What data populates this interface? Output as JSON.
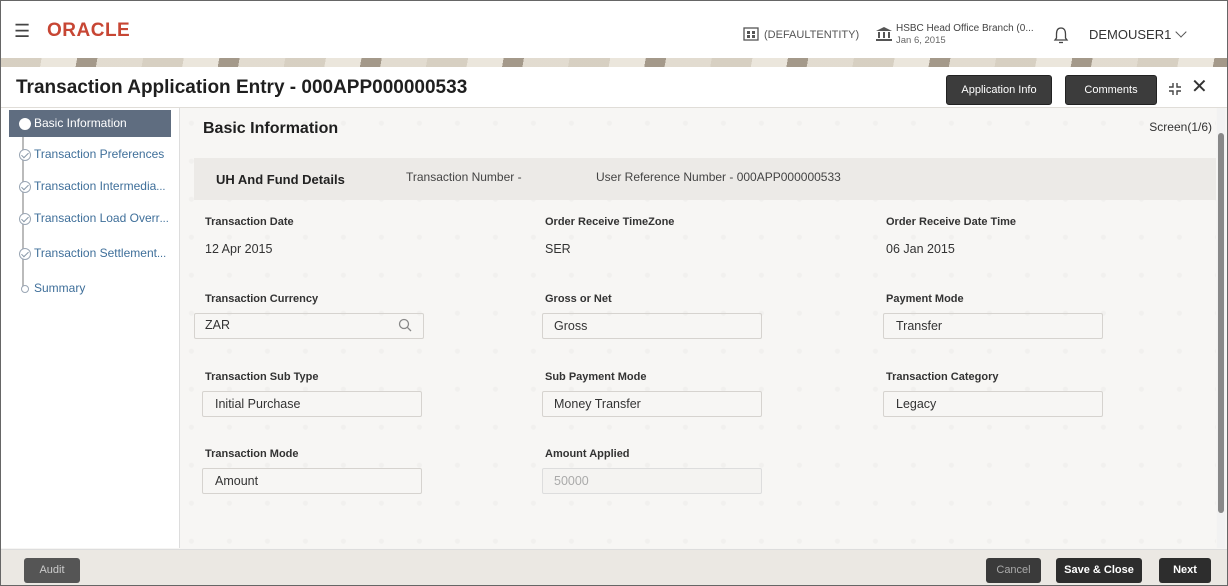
{
  "header": {
    "logo": "ORACLE",
    "entity": "(DEFAULTENTITY)",
    "branch_name": "HSBC Head Office Branch (0...",
    "branch_date": "Jan 6, 2015",
    "user": "DEMOUSER1",
    "brand_color": "#c74634"
  },
  "titlebar": {
    "title": "Transaction Application Entry - 000APP000000533",
    "app_info": "Application Info",
    "comments": "Comments"
  },
  "sidebar": {
    "items": [
      {
        "label": "Basic Information",
        "active": true
      },
      {
        "label": "Transaction Preferences"
      },
      {
        "label": "Transaction Intermedia",
        "ellipsis": "..."
      },
      {
        "label": "Transaction Load Overr",
        "ellipsis": "..."
      },
      {
        "label": "Transaction Settlement",
        "ellipsis": "..."
      },
      {
        "label": "Summary"
      }
    ]
  },
  "main": {
    "section_title": "Basic Information",
    "screen_counter": "Screen(1/6)",
    "tabs": {
      "uh_fund": "UH And Fund Details",
      "txn_number": "Transaction Number -",
      "user_ref": "User Reference Number - 000APP000000533"
    },
    "fields": {
      "transaction_date": {
        "label": "Transaction Date",
        "value": "12 Apr 2015"
      },
      "order_tz": {
        "label": "Order Receive TimeZone",
        "value": "SER"
      },
      "order_dt": {
        "label": "Order Receive Date Time",
        "value": "06 Jan 2015"
      },
      "currency": {
        "label": "Transaction Currency",
        "value": "ZAR"
      },
      "gross_net": {
        "label": "Gross or Net",
        "value": "Gross"
      },
      "payment_mode": {
        "label": "Payment Mode",
        "value": "Transfer"
      },
      "sub_type": {
        "label": "Transaction Sub Type",
        "value": "Initial Purchase"
      },
      "sub_payment": {
        "label": "Sub Payment Mode",
        "value": "Money Transfer"
      },
      "category": {
        "label": "Transaction Category",
        "value": "Legacy"
      },
      "mode": {
        "label": "Transaction Mode",
        "value": "Amount"
      },
      "amount_applied": {
        "label": "Amount Applied",
        "value": "50000"
      }
    }
  },
  "footer": {
    "audit": "Audit",
    "cancel": "Cancel",
    "save_close": "Save & Close",
    "next": "Next"
  }
}
